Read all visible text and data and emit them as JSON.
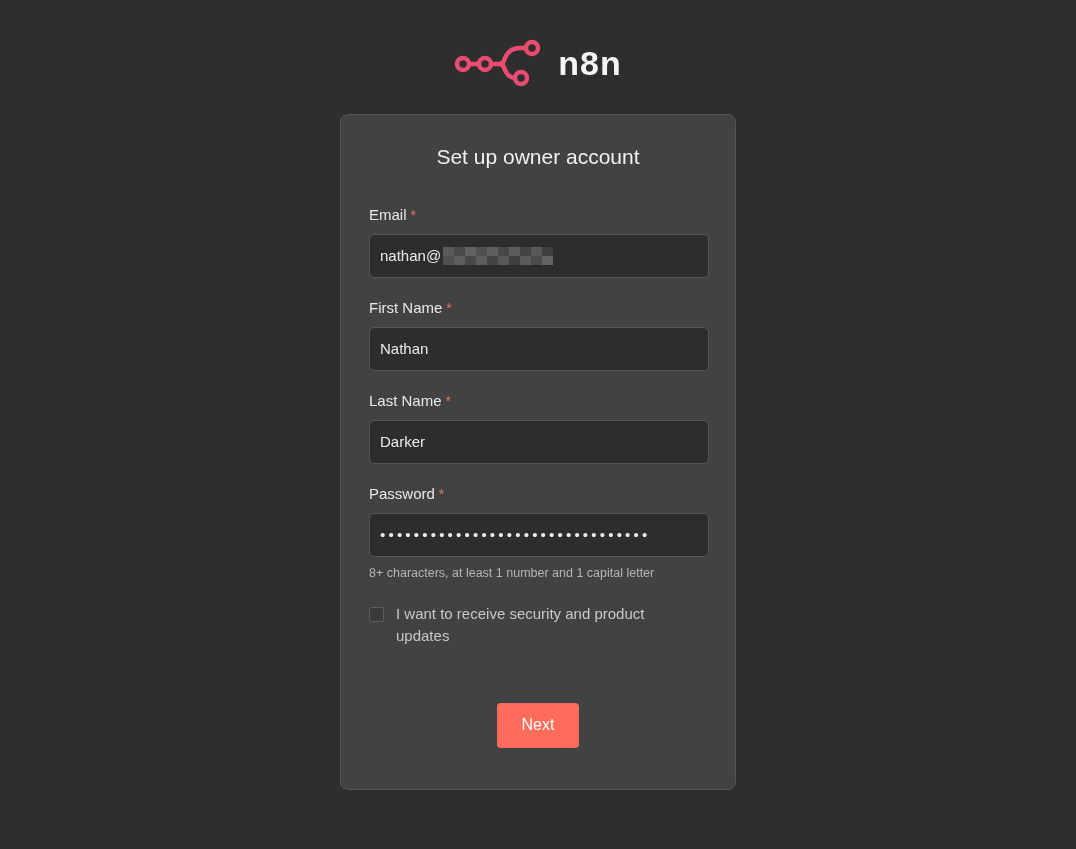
{
  "logo": {
    "wordmark": "n8n"
  },
  "card": {
    "title": "Set up owner account",
    "fields": [
      {
        "kind": "text",
        "label": "Email",
        "required": "*",
        "value": "nathan@",
        "redacted": true
      },
      {
        "kind": "text",
        "label": "First Name",
        "required": "*",
        "value": "Nathan",
        "redacted": false
      },
      {
        "kind": "text",
        "label": "Last Name",
        "required": "*",
        "value": "Darker",
        "redacted": false
      },
      {
        "kind": "password",
        "label": "Password",
        "required": "*",
        "value": "••••••••••••••••••••••••••••••••",
        "redacted": false,
        "hint": "8+ characters, at least 1 number and 1 capital letter"
      }
    ],
    "checkbox": {
      "label": "I want to receive security and product updates",
      "checked": false
    },
    "button": "Next"
  }
}
